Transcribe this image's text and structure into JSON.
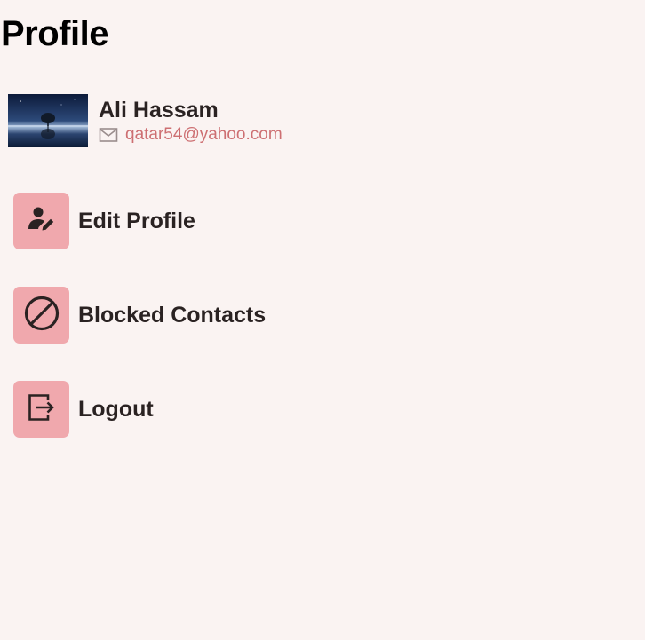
{
  "page": {
    "title": "Profile"
  },
  "profile": {
    "name": "Ali Hassam",
    "email": "qatar54@yahoo.com",
    "avatar_icon": "landscape-photo-avatar"
  },
  "menu": {
    "items": [
      {
        "label": "Edit Profile",
        "icon": "user-edit-icon"
      },
      {
        "label": "Blocked Contacts",
        "icon": "block-icon"
      },
      {
        "label": "Logout",
        "icon": "logout-icon"
      }
    ]
  },
  "colors": {
    "background": "#faf3f2",
    "accent": "#f0a8ad",
    "email": "#cd6f72",
    "text": "#2a2222"
  }
}
